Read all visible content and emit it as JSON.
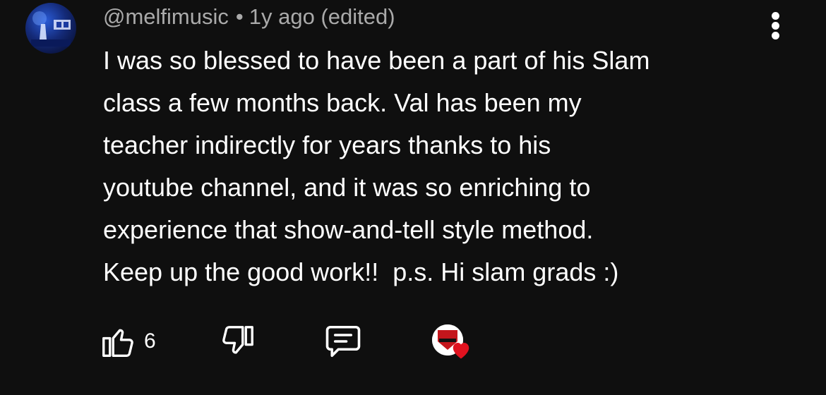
{
  "comment": {
    "author": "@melfimusic",
    "separator": "•",
    "time": "1y ago (edited)",
    "body": "I was so blessed to have been a part of his Slam\nclass a few months back. Val has been my\nteacher indirectly for years thanks to his\nyoutube channel, and it was so enriching to\nexperience that show-and-tell style method.\nKeep up the good work!!  p.s. Hi slam grads :)"
  },
  "actions": {
    "like_count": "6",
    "like_icon": "thumbs-up-icon",
    "dislike_icon": "thumbs-down-icon",
    "reply_icon": "reply-icon",
    "menu_icon": "more-vertical-icon"
  },
  "colors": {
    "background": "#0f0f0f",
    "text": "#ffffff",
    "meta_text": "#aaaaaa",
    "heart": "#e0121f"
  }
}
